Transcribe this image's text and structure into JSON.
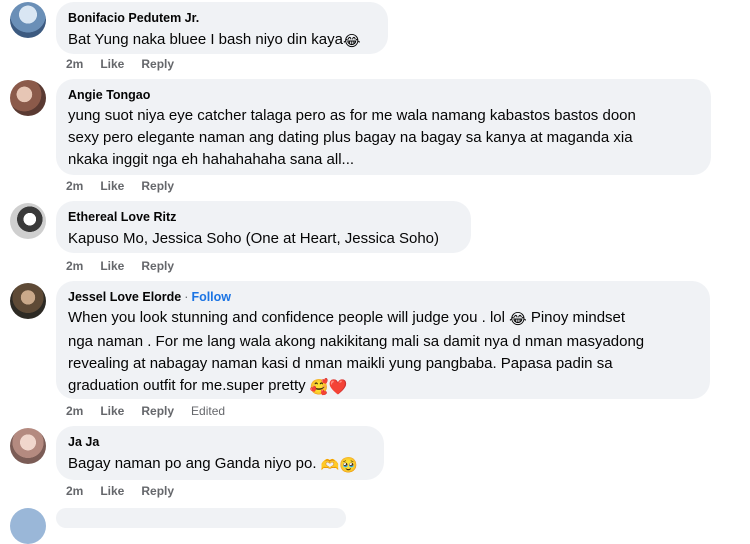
{
  "comments": [
    {
      "author": "Bonifacio Pedutem Jr.",
      "text": "Bat Yung naka bluee I bash niyo din kaya",
      "emoji": "😂",
      "time": "2m",
      "like": "Like",
      "reply": "Reply"
    },
    {
      "author": "Angie Tongao",
      "lines": [
        "yung suot niya eye catcher talaga pero as for me wala namang kabastos bastos doon",
        "sexy pero elegante naman ang dating plus bagay na bagay sa kanya at maganda xia",
        "nkaka inggit nga eh hahahahaha sana all..."
      ],
      "time": "2m",
      "like": "Like",
      "reply": "Reply"
    },
    {
      "author": "Ethereal Love Ritz",
      "text": "Kapuso Mo, Jessica Soho (One at Heart, Jessica Soho)",
      "time": "2m",
      "like": "Like",
      "reply": "Reply"
    },
    {
      "author": "Jessel Love Elorde",
      "follow": "Follow",
      "line1_a": "When you look stunning and confidence people will judge you . lol",
      "line1_emoji": "😂",
      "line1_b": "Pinoy mindset",
      "lines_rest": [
        "nga naman . For me lang wala akong nakikitang mali sa damit nya d nman masyadong",
        "revealing at nabagay naman kasi d nman maikli yung pangbaba. Papasa padin sa"
      ],
      "last_line": "graduation outfit for me.super pretty",
      "last_emoji": "🥰❤️",
      "time": "2m",
      "like": "Like",
      "reply": "Reply",
      "edited": "Edited"
    },
    {
      "author": "Ja Ja",
      "text": "Bagay naman po ang Ganda niyo po.",
      "emoji": "🫶🥹",
      "time": "2m",
      "like": "Like",
      "reply": "Reply"
    }
  ],
  "colors": {
    "bubble": "#f0f2f5",
    "meta": "#65676b",
    "link": "#1b74e4"
  }
}
